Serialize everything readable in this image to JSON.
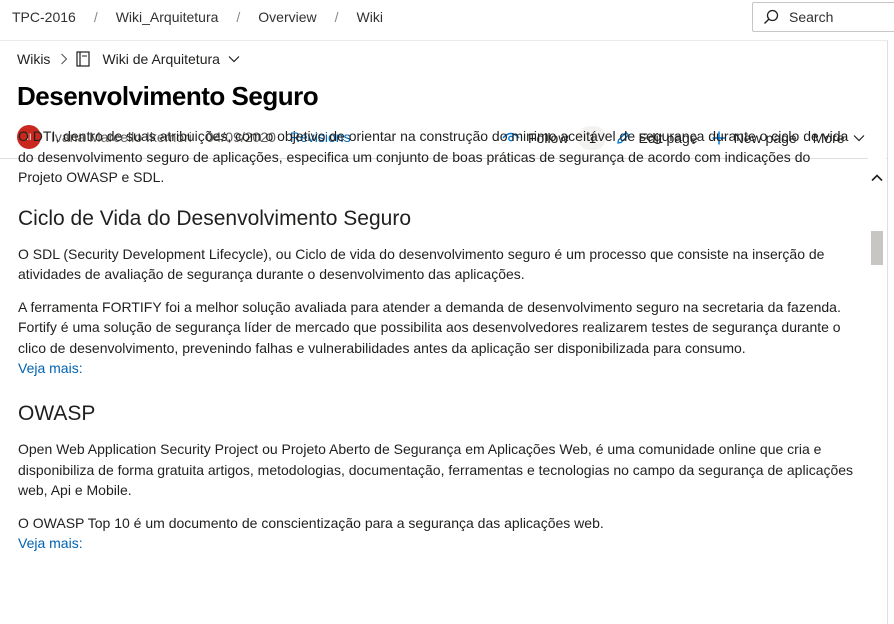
{
  "breadcrumb": {
    "items": [
      "TPC-2016",
      "Wiki_Arquitetura",
      "Overview",
      "Wiki"
    ],
    "separator": "/"
  },
  "search": {
    "label": "Search",
    "icon": "search-icon"
  },
  "wiki_nav": {
    "root": "Wikis",
    "current": "Wiki de Arquitetura"
  },
  "page": {
    "title": "Desenvolvimento Seguro",
    "author_initials": "II",
    "author": "Ivana Marcello Ikemori",
    "date": "04/09/2020",
    "revisions_label": "Revisions"
  },
  "actions": {
    "follow_label": "Follow",
    "follow_count": "1",
    "edit_label": "Edit page",
    "new_label": "New page",
    "more_label": "More"
  },
  "content": {
    "intro": "O DTI, dentro de suas atribuições, com o objetivo de orientar na construção do minimo aceitável de segurança durante o ciclo de vida do desenvolvimento seguro de aplicações, especifica um conjunto de boas práticas de segurança de acordo com indicações do Projeto OWASP e SDL.",
    "section1_title": "Ciclo de Vida do Desenvolvimento Seguro",
    "section1_p1": "O SDL (Security Development Lifecycle), ou Ciclo de vida do desenvolvimento seguro é um processo que consiste na inserção de atividades de avaliação de segurança durante o desenvolvimento das aplicações.",
    "section1_p2": "A ferramenta FORTIFY foi a melhor solução avaliada para atender a demanda de desenvolvimento seguro na secretaria da fazenda. Fortify é uma solução de segurança líder de mercado que possibilita aos desenvolvedores realizarem testes de segurança durante o clico de desenvolvimento, prevenindo falhas e vulnerabilidades antes da aplicação ser disponibilizada para consumo.",
    "section1_link": "Veja mais:",
    "section2_title": "OWASP",
    "section2_p1": "Open Web Application Security Project ou Projeto Aberto de Segurança em Aplicações Web, é uma comunidade online que cria e disponibiliza de forma gratuita artigos, metodologias, documentação, ferramentas e tecnologias no campo da segurança de aplicações web, Api e Mobile.",
    "section2_p2": "O OWASP Top 10 é um documento de conscientização para a segurança das aplicações web.",
    "section2_link": "Veja mais:"
  },
  "colors": {
    "link": "#0063b1",
    "avatar_bg": "#c8281e",
    "accent_blue": "#0078d4"
  }
}
